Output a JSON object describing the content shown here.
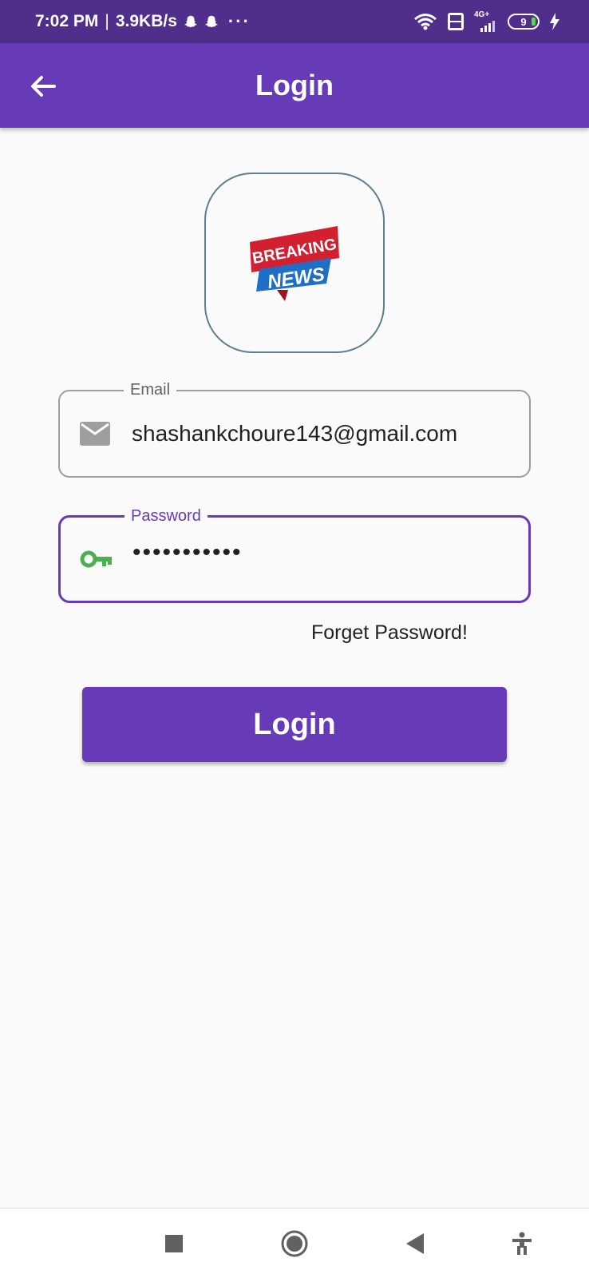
{
  "status_bar": {
    "time": "7:02 PM",
    "separator": "|",
    "speed": "3.9KB/s",
    "more": "···",
    "battery": "9",
    "network": "4G+"
  },
  "app_bar": {
    "title": "Login",
    "back_icon": "arrow-back-icon"
  },
  "logo": {
    "line1": "BREAKING",
    "line2": "NEWS"
  },
  "email": {
    "label": "Email",
    "value": "shashankchoure143@gmail.com",
    "icon": "mail-icon"
  },
  "password": {
    "label": "Password",
    "value": "•••••••••••",
    "icon": "key-icon"
  },
  "forget_password": "Forget Password!",
  "login_button": "Login",
  "colors": {
    "primary": "#673ab7",
    "status_bar": "#4f2e8c",
    "key_icon": "#4caf50",
    "mail_icon": "#9e9e9e",
    "logo_red": "#d32030",
    "logo_blue": "#1f6fc6"
  }
}
